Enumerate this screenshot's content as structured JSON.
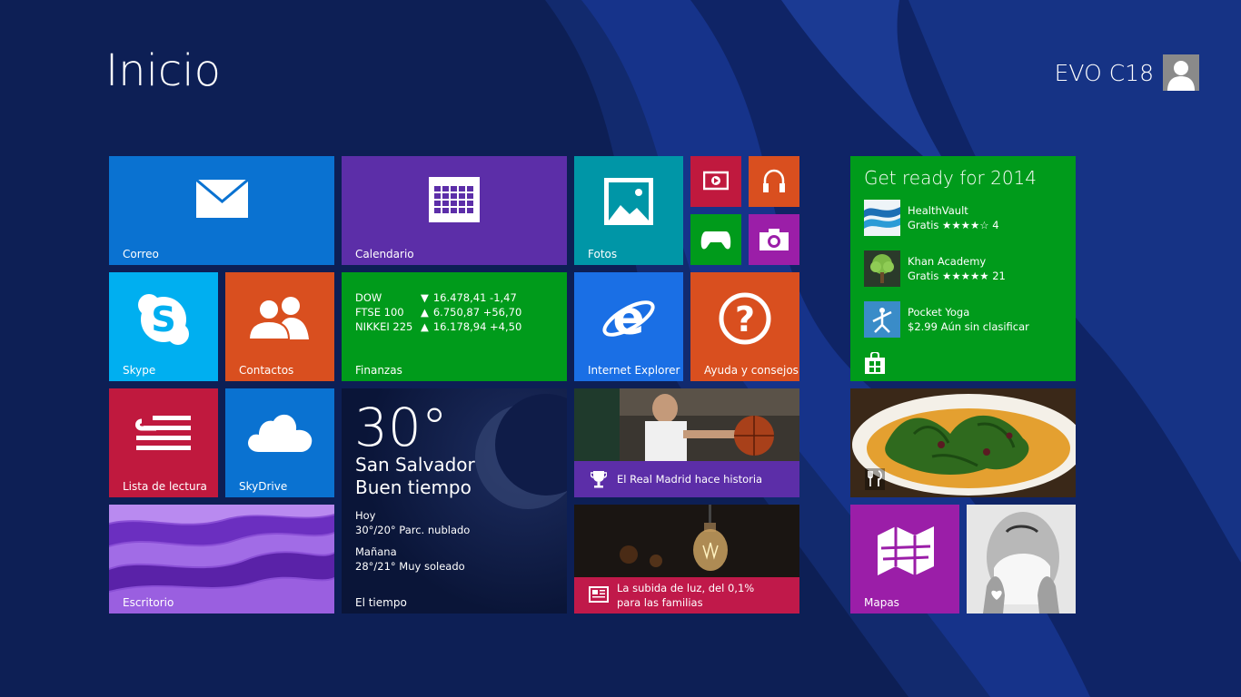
{
  "header": {
    "title": "Inicio",
    "user_name": "EVO C18"
  },
  "colors": {
    "background": "#0d1f55",
    "blue": "#0a72d1",
    "purple": "#5c2ea8",
    "green": "#009b1b",
    "teal": "#0096a7",
    "skype": "#00aff0",
    "orange": "#d94f1f",
    "red": "#c0193e",
    "magenta": "#9b1ea8",
    "ie_blue": "#1a6fe5",
    "news_red": "#c0194a"
  },
  "tiles": {
    "mail": {
      "label": "Correo",
      "icon": "mail-icon"
    },
    "calendar": {
      "label": "Calendario",
      "icon": "calendar-icon"
    },
    "photos": {
      "label": "Fotos",
      "icon": "photos-icon"
    },
    "video": {
      "icon": "video-icon"
    },
    "music": {
      "icon": "headphones-icon"
    },
    "games": {
      "icon": "gamepad-icon"
    },
    "camera": {
      "icon": "camera-icon"
    },
    "skype": {
      "label": "Skype",
      "icon": "skype-icon"
    },
    "people": {
      "label": "Contactos",
      "icon": "people-icon"
    },
    "finance": {
      "label": "Finanzas",
      "rows": [
        {
          "name": "DOW",
          "direction": "down",
          "value": "16.478,41 -1,47"
        },
        {
          "name": "FTSE 100",
          "direction": "up",
          "value": "6.750,87 +56,70"
        },
        {
          "name": "NIKKEI 225",
          "direction": "up",
          "value": "16.178,94 +4,50"
        }
      ]
    },
    "ie": {
      "label": "Internet Explorer",
      "icon": "internet-explorer-icon"
    },
    "help": {
      "label": "Ayuda y consejos",
      "icon": "help-icon"
    },
    "reading": {
      "label": "Lista de lectura",
      "icon": "reading-list-icon"
    },
    "skydrive": {
      "label": "SkyDrive",
      "icon": "cloud-icon"
    },
    "weather": {
      "label": "El tiempo",
      "temp": "30°",
      "city": "San Salvador",
      "condition": "Buen tiempo",
      "today_label": "Hoy",
      "today_forecast": "30°/20° Parc. nublado",
      "tomorrow_label": "Mañana",
      "tomorrow_forecast": "28°/21° Muy soleado"
    },
    "sports": {
      "headline": "El Real Madrid hace historia",
      "icon": "trophy-icon"
    },
    "news": {
      "headline_line1": "La subida de luz, del 0,1%",
      "headline_line2": "para las familias",
      "icon": "newspaper-icon"
    },
    "desktop": {
      "label": "Escritorio"
    },
    "store": {
      "title": "Get ready for 2014",
      "items": [
        {
          "name": "HealthVault",
          "detail": "Gratis ★★★★☆ 4"
        },
        {
          "name": "Khan Academy",
          "detail": "Gratis ★★★★★ 21"
        },
        {
          "name": "Pocket Yoga",
          "detail": "$2.99 Aún sin clasificar"
        }
      ]
    },
    "food": {
      "icon": "fork-knife-icon"
    },
    "maps": {
      "label": "Mapas",
      "icon": "map-icon"
    },
    "health": {
      "icon": "health-icon"
    }
  }
}
